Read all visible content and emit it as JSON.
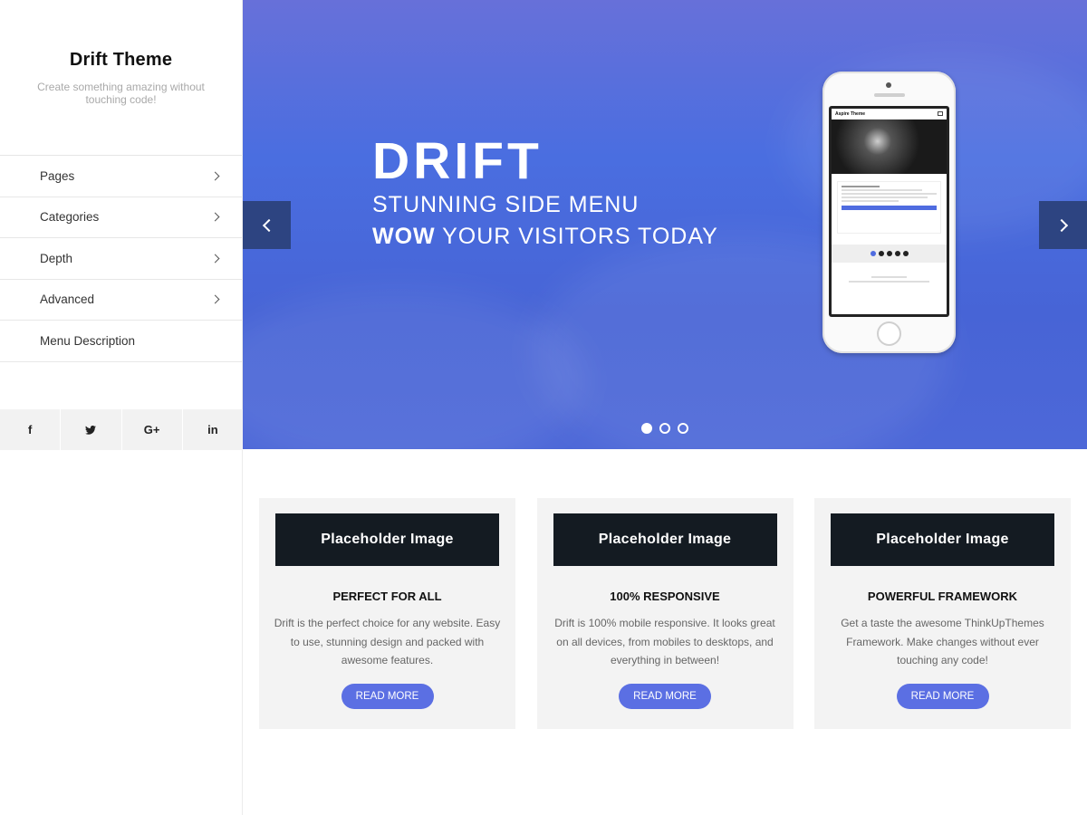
{
  "site": {
    "title": "Drift Theme",
    "tagline": "Create something amazing without touching code!"
  },
  "menu": [
    {
      "label": "Pages",
      "has_children": true
    },
    {
      "label": "Categories",
      "has_children": true
    },
    {
      "label": "Depth",
      "has_children": true
    },
    {
      "label": "Advanced",
      "has_children": true
    },
    {
      "label": "Menu Description",
      "has_children": false
    }
  ],
  "social": [
    {
      "name": "facebook-icon",
      "glyph": "f"
    },
    {
      "name": "twitter-icon",
      "glyph": "🐦"
    },
    {
      "name": "google-plus-icon",
      "glyph": "G+"
    },
    {
      "name": "linkedin-icon",
      "glyph": "in"
    }
  ],
  "hero": {
    "title": "DRIFT",
    "line1": "STUNNING SIDE MENU",
    "line2_bold": "WOW",
    "line2_rest": " YOUR VISITORS TODAY",
    "slide_count": 3,
    "active_slide": 1,
    "phone_screen_title": "Aspire Theme"
  },
  "features": [
    {
      "image_label": "Placeholder Image",
      "title": "PERFECT FOR ALL",
      "text": "Drift is the perfect choice for any website. Easy to use, stunning design and packed with awesome features.",
      "button": "READ MORE"
    },
    {
      "image_label": "Placeholder Image",
      "title": "100% RESPONSIVE",
      "text": "Drift is 100% mobile responsive. It looks great on all devices, from mobiles to desktops, and everything in between!",
      "button": "READ MORE"
    },
    {
      "image_label": "Placeholder Image",
      "title": "POWERFUL FRAMEWORK",
      "text": "Get a taste the awesome ThinkUpThemes Framework. Make changes without ever touching any code!",
      "button": "READ MORE"
    }
  ],
  "colors": {
    "accent": "#5b6fe3",
    "slider_arrow": "#2d4481",
    "placeholder_bg": "#141b22",
    "card_bg": "#f3f3f3"
  }
}
